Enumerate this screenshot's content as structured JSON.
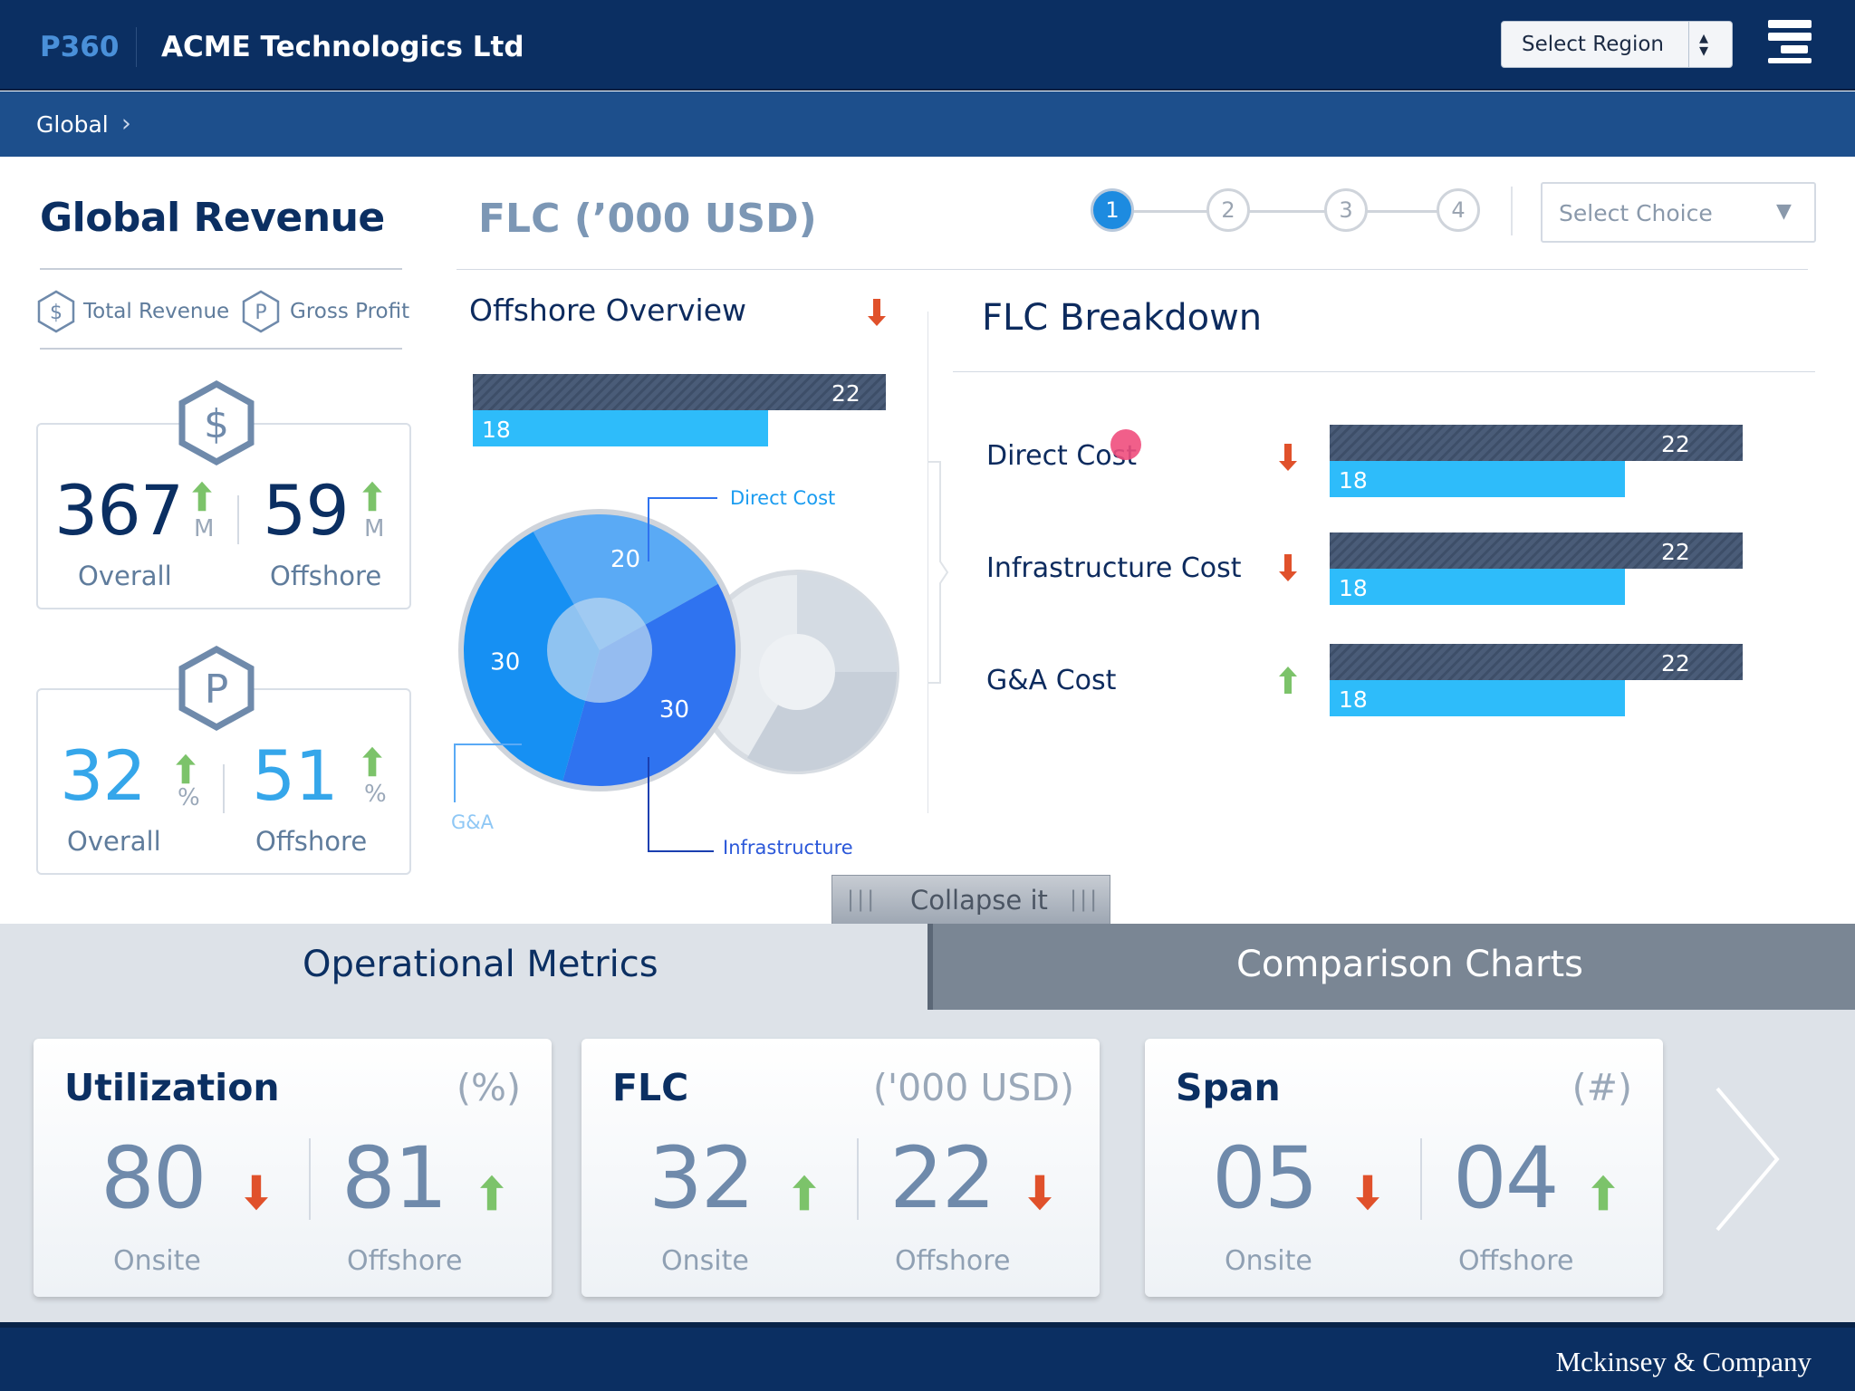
{
  "header": {
    "brand": "P360",
    "company": "ACME Technologics Ltd",
    "region_select": {
      "label": "Select Region",
      "options": [
        "Select Region"
      ]
    },
    "menu_icon": "menu-icon"
  },
  "breadcrumb": {
    "items": [
      "Global"
    ]
  },
  "revenue": {
    "title": "Global Revenue",
    "legend": [
      {
        "icon": "dollar-hex-icon",
        "label": "Total Revenue"
      },
      {
        "icon": "p-hex-icon",
        "label": "Gross Profit"
      }
    ],
    "total": {
      "icon_letter": "$",
      "overall": {
        "value": "367",
        "unit": "M",
        "label": "Overall",
        "trend": "up"
      },
      "offshore": {
        "value": "59",
        "unit": "M",
        "label": "Offshore",
        "trend": "up"
      }
    },
    "profit": {
      "icon_letter": "P",
      "overall": {
        "value": "32",
        "unit": "%",
        "label": "Overall",
        "trend": "up"
      },
      "offshore": {
        "value": "51",
        "unit": "%",
        "label": "Offshore",
        "trend": "up"
      }
    }
  },
  "flc": {
    "title": "FLC (’000 USD)",
    "steps": [
      "1",
      "2",
      "3",
      "4"
    ],
    "active_step": 0,
    "choice_select": {
      "label": "Select Choice"
    },
    "offshore_overview": {
      "title": "Offshore Overview",
      "trend": "down",
      "bars": {
        "dark": "22",
        "light": "18"
      }
    },
    "pie_callouts": {
      "direct": "Direct Cost",
      "ga": "G&A",
      "infra": "Infrastructure"
    },
    "breakdown": {
      "title": "FLC Breakdown",
      "rows": [
        {
          "label": "Direct Cost",
          "trend": "down",
          "dark": "22",
          "light": "18"
        },
        {
          "label": "Infrastructure Cost",
          "trend": "down",
          "dark": "22",
          "light": "18"
        },
        {
          "label": "G&A Cost",
          "trend": "up",
          "dark": "22",
          "light": "18"
        }
      ]
    }
  },
  "chart_data": {
    "type": "pie",
    "categories": [
      "Direct Cost",
      "Infrastructure",
      "G&A"
    ],
    "values": [
      20,
      30,
      30
    ],
    "colors": [
      "#5aaaf5",
      "#2f73f0",
      "#1690f3"
    ]
  },
  "collapse": {
    "label": "Collapse it"
  },
  "tabs": [
    {
      "label": "Operational Metrics",
      "active": true
    },
    {
      "label": "Comparison Charts",
      "active": false
    }
  ],
  "metrics": [
    {
      "title": "Utilization",
      "unit": "(%)",
      "onsite": "80",
      "onsite_trend": "down",
      "offshore": "81",
      "offshore_trend": "up",
      "onsite_label": "Onsite",
      "offshore_label": "Offshore"
    },
    {
      "title": "FLC",
      "unit": "('000 USD)",
      "onsite": "32",
      "onsite_trend": "up",
      "offshore": "22",
      "offshore_trend": "down",
      "onsite_label": "Onsite",
      "offshore_label": "Offshore"
    },
    {
      "title": "Span",
      "unit": "(#)",
      "onsite": "05",
      "onsite_trend": "down",
      "offshore": "04",
      "offshore_trend": "up",
      "onsite_label": "Onsite",
      "offshore_label": "Offshore"
    }
  ],
  "footer": {
    "label": "Mckinsey & Company"
  },
  "colors": {
    "navy": "#0b2f62",
    "up": "#7cc36a",
    "down": "#e0512b",
    "bar_dark": "#4a5c78",
    "bar_light": "#2ebcfa"
  }
}
